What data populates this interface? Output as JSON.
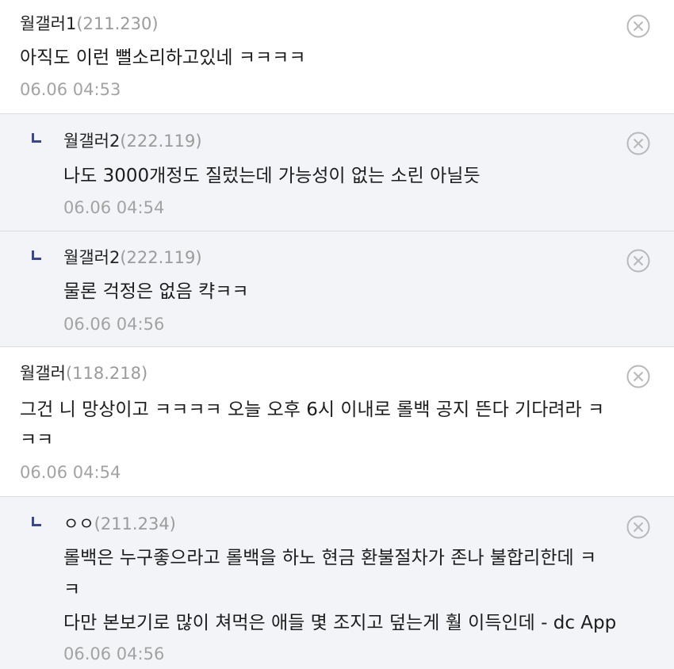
{
  "comments": [
    {
      "nick": "월갤러1",
      "ip": "(211.230)",
      "lines": [
        "아직도 이런 뻘소리하고있네 ㅋㅋㅋㅋ"
      ],
      "date": "06.06 04:53",
      "reply": false
    },
    {
      "nick": "월갤러2",
      "ip": "(222.119)",
      "lines": [
        "나도 3000개정도 질렀는데 가능성이 없는 소린 아닐듯"
      ],
      "date": "06.06 04:54",
      "reply": true
    },
    {
      "nick": "월갤러2",
      "ip": "(222.119)",
      "lines": [
        "물론 걱정은 없음 캭ㅋㅋ"
      ],
      "date": "06.06 04:56",
      "reply": true
    },
    {
      "nick": "월갤러",
      "ip": "(118.218)",
      "lines": [
        "그건 니 망상이고 ㅋㅋㅋㅋ 오늘 오후 6시 이내로 롤백 공지 뜬다 기다려라 ㅋ",
        "ㅋㅋ"
      ],
      "date": "06.06 04:54",
      "reply": false
    },
    {
      "nick": "ㅇㅇ",
      "ip": "(211.234)",
      "lines": [
        "롤백은 누구좋으라고 롤백을 하노 현금 환불절차가 존나 불합리한데 ㅋ",
        "ㅋ",
        "다만 본보기로 많이 쳐먹은 애들 몇 조지고 덮는게 훨 이득인데 - dc App"
      ],
      "date": "06.06 04:56",
      "reply": true
    }
  ],
  "icons": {
    "delete": "close-circle-icon",
    "reply": "reply-arrow-icon"
  },
  "colors": {
    "reply_background": "#f3f4f7",
    "reply_marker": "#3b4890",
    "meta_text": "#9b9b9b",
    "divider": "#dcdde3"
  }
}
